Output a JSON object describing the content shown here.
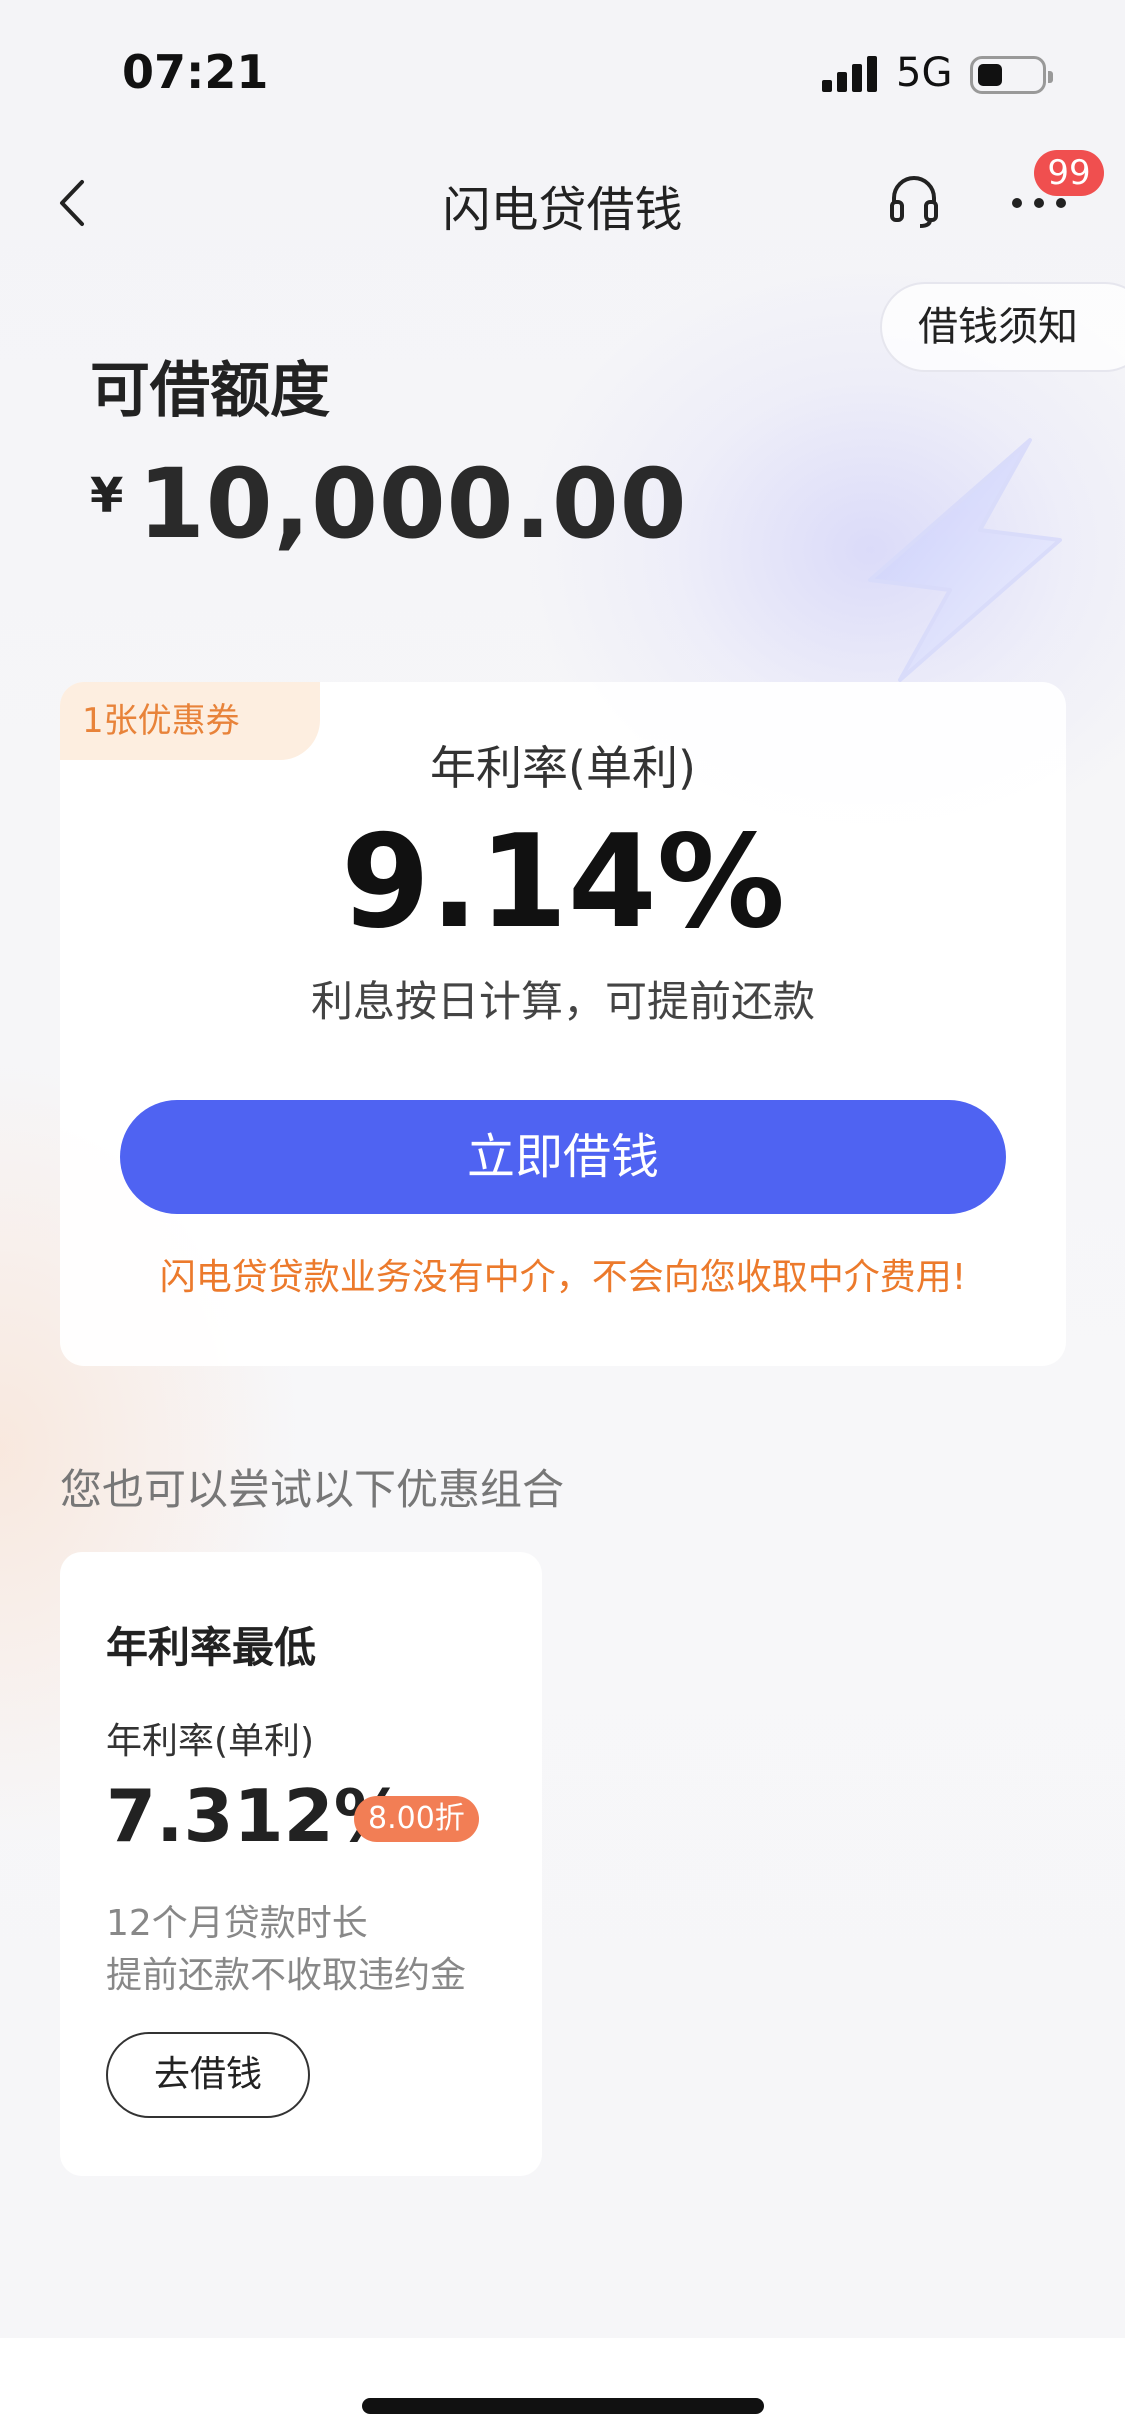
{
  "status_bar": {
    "time": "07:21",
    "network": "5G"
  },
  "nav": {
    "title": "闪电贷借钱",
    "badge_count": "99"
  },
  "notice": {
    "label": "借钱须知"
  },
  "credit": {
    "label": "可借额度",
    "currency": "¥",
    "amount": "10,000.00"
  },
  "main_card": {
    "coupon": "1张优惠券",
    "rate_label": "年利率(单利)",
    "rate_value": "9.14%",
    "rate_note": "利息按日计算，可提前还款",
    "button": "立即借钱",
    "disclaimer": "闪电贷贷款业务没有中介，不会向您收取中介费用!"
  },
  "section": {
    "title": "您也可以尝试以下优惠组合"
  },
  "offer": {
    "title": "年利率最低",
    "rate_label": "年利率(单利)",
    "rate_value": "7.312%",
    "discount": "8.00折",
    "line1": "12个月贷款时长",
    "line2": "提前还款不收取违约金",
    "button": "去借钱"
  },
  "colors": {
    "primary": "#4f63f2",
    "warning": "#ec7a2c",
    "badge": "#f04f4f",
    "discount": "#f27e55"
  }
}
